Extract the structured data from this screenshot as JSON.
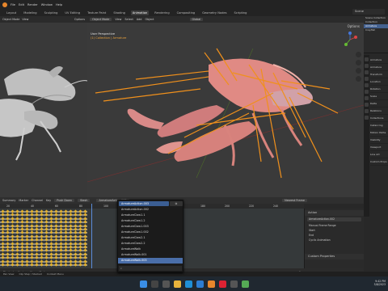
{
  "menu": {
    "items": [
      "File",
      "Edit",
      "Render",
      "Window",
      "Help"
    ]
  },
  "tabs": {
    "items": [
      "Layout",
      "Modeling",
      "Sculpting",
      "UV Editing",
      "Texture Paint",
      "Shading",
      "Animation",
      "Rendering",
      "Compositing",
      "Geometry Nodes",
      "Scripting"
    ],
    "active_index": 6
  },
  "scene_name": "Scene",
  "left_viewport": {
    "header": [
      "Object Mode",
      "View",
      "Options"
    ]
  },
  "main_viewport": {
    "mode": "Object Mode",
    "menus": [
      "View",
      "Select",
      "Add",
      "Object"
    ],
    "transform": "Global",
    "options": "Options",
    "info_line1": "User Perspective",
    "info_line2": "(1) Collection | Armature"
  },
  "outliner": {
    "items": [
      "Scene Collection",
      "Collection",
      "Armature",
      "Crayfish"
    ],
    "selected_index": 2
  },
  "properties": {
    "rows": [
      "Armature",
      "Armature",
      "Transform",
      "Location",
      "Rotation",
      "Scale",
      "Delta",
      "Relations",
      "Collections",
      "Instancing",
      "Motion Paths",
      "Visibility",
      "Viewport",
      "Line Art",
      "Custom Props"
    ]
  },
  "timeline": {
    "header_items": [
      "Summary",
      "Marker",
      "Channel",
      "Key"
    ],
    "push_down_label": "Push Down",
    "stash_label": "Stash",
    "action_name": "ArmatureAction.003",
    "keying": "Nearest Frame",
    "ruler_labels": [
      "20",
      "40",
      "60",
      "80",
      "100",
      "120",
      "140",
      "160",
      "180",
      "200",
      "220",
      "240"
    ],
    "footer": [
      "Playback",
      "Keying",
      "View",
      "Marker"
    ],
    "frame_current": "1"
  },
  "action_panel": {
    "section_action": "Action",
    "action_field": "ArmatureAction.002",
    "manual_frame_range": "Manual Frame Range",
    "start": "Start",
    "end": "End",
    "cyclic": "Cyclic Animation",
    "custom_props": "Custom Properties"
  },
  "action_dropdown": {
    "button_label": "ArmatureAction.003",
    "items": [
      "ArmatureAction.002",
      "ArmatureClaw1.1",
      "ArmatureClaw1.2",
      "ArmatureClaw1.003",
      "ArmatureClaw1.002",
      "ArmatureClaw2.1",
      "ArmatureClaw2.2",
      "ArmatureWalk",
      "ArmatureWalk.001",
      "ArmatureWalk.003"
    ],
    "selected_index": 9
  },
  "statusbar": {
    "items": [
      "Pan View",
      "Clip Step / Stacked",
      "Context Menu"
    ]
  },
  "tray": {
    "time": "9:42 PM",
    "date": "5/8/2023"
  },
  "colors": {
    "bone": "#f0901c",
    "body": "#d88080",
    "accent": "#4a6ea9"
  }
}
